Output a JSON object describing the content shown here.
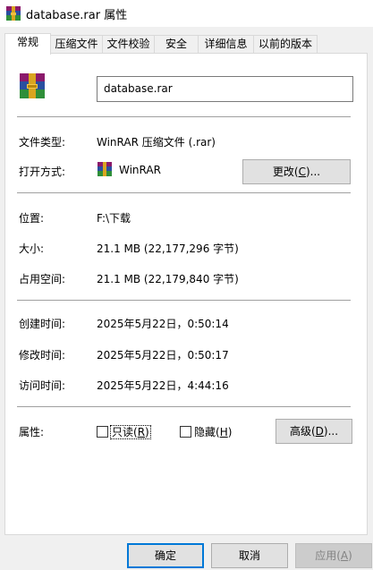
{
  "window": {
    "title": "database.rar 属性",
    "icon": "winrar-archive-icon"
  },
  "tabs": [
    {
      "label": "常规",
      "active": true
    },
    {
      "label": "压缩文件",
      "active": false
    },
    {
      "label": "文件校验",
      "active": false
    },
    {
      "label": "安全",
      "active": false
    },
    {
      "label": "详细信息",
      "active": false
    },
    {
      "label": "以前的版本",
      "active": false
    }
  ],
  "general": {
    "filename": "database.rar",
    "file_type_label": "文件类型:",
    "file_type_value": "WinRAR 压缩文件 (.rar)",
    "open_with_label": "打开方式:",
    "open_with_value": "WinRAR",
    "change_button": {
      "text": "更改(",
      "key": "C",
      "suffix": ")..."
    },
    "location_label": "位置:",
    "location_value": "F:\\下载",
    "size_label": "大小:",
    "size_value": "21.1 MB (22,177,296 字节)",
    "disk_size_label": "占用空间:",
    "disk_size_value": "21.1 MB (22,179,840 字节)",
    "created_label": "创建时间:",
    "created_value": "2025年5月22日，0:50:14",
    "modified_label": "修改时间:",
    "modified_value": "2025年5月22日，0:50:17",
    "accessed_label": "访问时间:",
    "accessed_value": "2025年5月22日，4:44:16",
    "attributes_label": "属性:",
    "readonly": {
      "text": "只读(",
      "key": "R",
      "suffix": ")",
      "checked": false
    },
    "hidden": {
      "text": "隐藏(",
      "key": "H",
      "suffix": ")",
      "checked": false
    },
    "advanced_button": {
      "text": "高级(",
      "key": "D",
      "suffix": ")..."
    }
  },
  "footer": {
    "ok": "确定",
    "cancel": "取消",
    "apply": {
      "text": "应用(",
      "key": "A",
      "suffix": ")"
    }
  },
  "colors": {
    "focus_border": "#0078d7",
    "separator": "#a0a0a0",
    "disabled_text": "#838383"
  }
}
